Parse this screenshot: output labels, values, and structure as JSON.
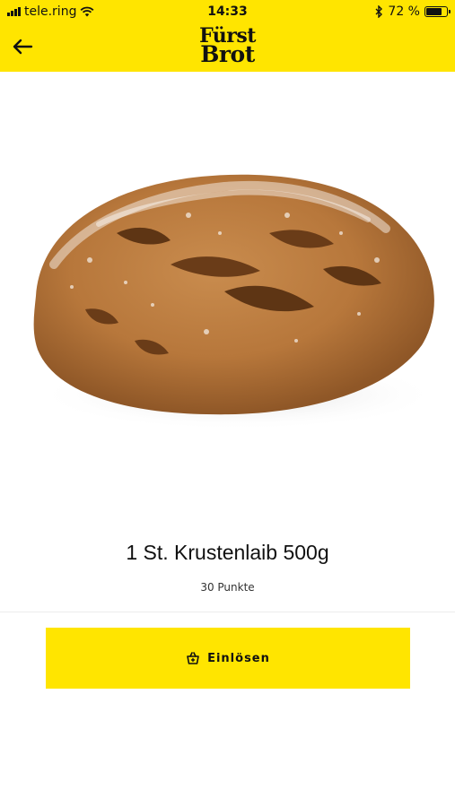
{
  "status_bar": {
    "carrier": "tele.ring",
    "time": "14:33",
    "battery": "72 %"
  },
  "header": {
    "logo_line1": "Fürst",
    "logo_line2": "Brot",
    "back_icon": "arrow-left-icon",
    "background": "#FFE500"
  },
  "product": {
    "title": "1 St. Krustenlaib 500g",
    "points": "30 Punkte",
    "image": "bread-loaf"
  },
  "action": {
    "redeem_label": "Einlösen",
    "icon": "basket-icon",
    "color": "#FFE500"
  }
}
